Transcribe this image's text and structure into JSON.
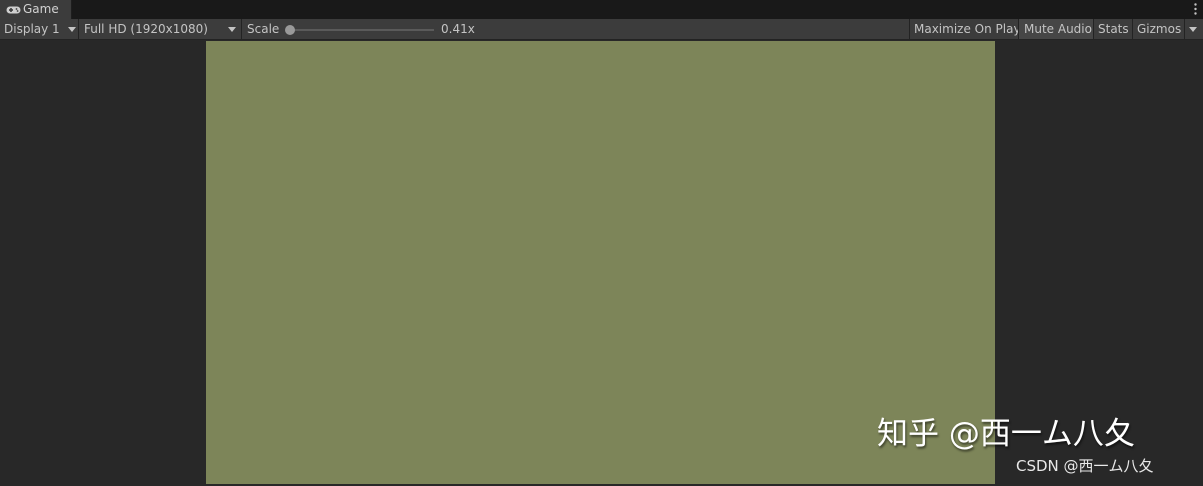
{
  "tab": {
    "icon": "gamepad-icon",
    "label": "Game"
  },
  "toolbar": {
    "display": "Display 1",
    "resolution": "Full HD (1920x1080)",
    "scale_label": "Scale",
    "scale_value": "0.41x",
    "maximize_on_play": "Maximize On Play",
    "mute_audio": "Mute Audio",
    "stats": "Stats",
    "gizmos": "Gizmos"
  },
  "colors": {
    "viewport_background": "#7d8559",
    "editor_background": "#282828",
    "toolbar_background": "#3c3c3c"
  },
  "watermark": {
    "primary": "知乎 @西一ム八夂",
    "secondary": "CSDN @西一ム八夂"
  }
}
